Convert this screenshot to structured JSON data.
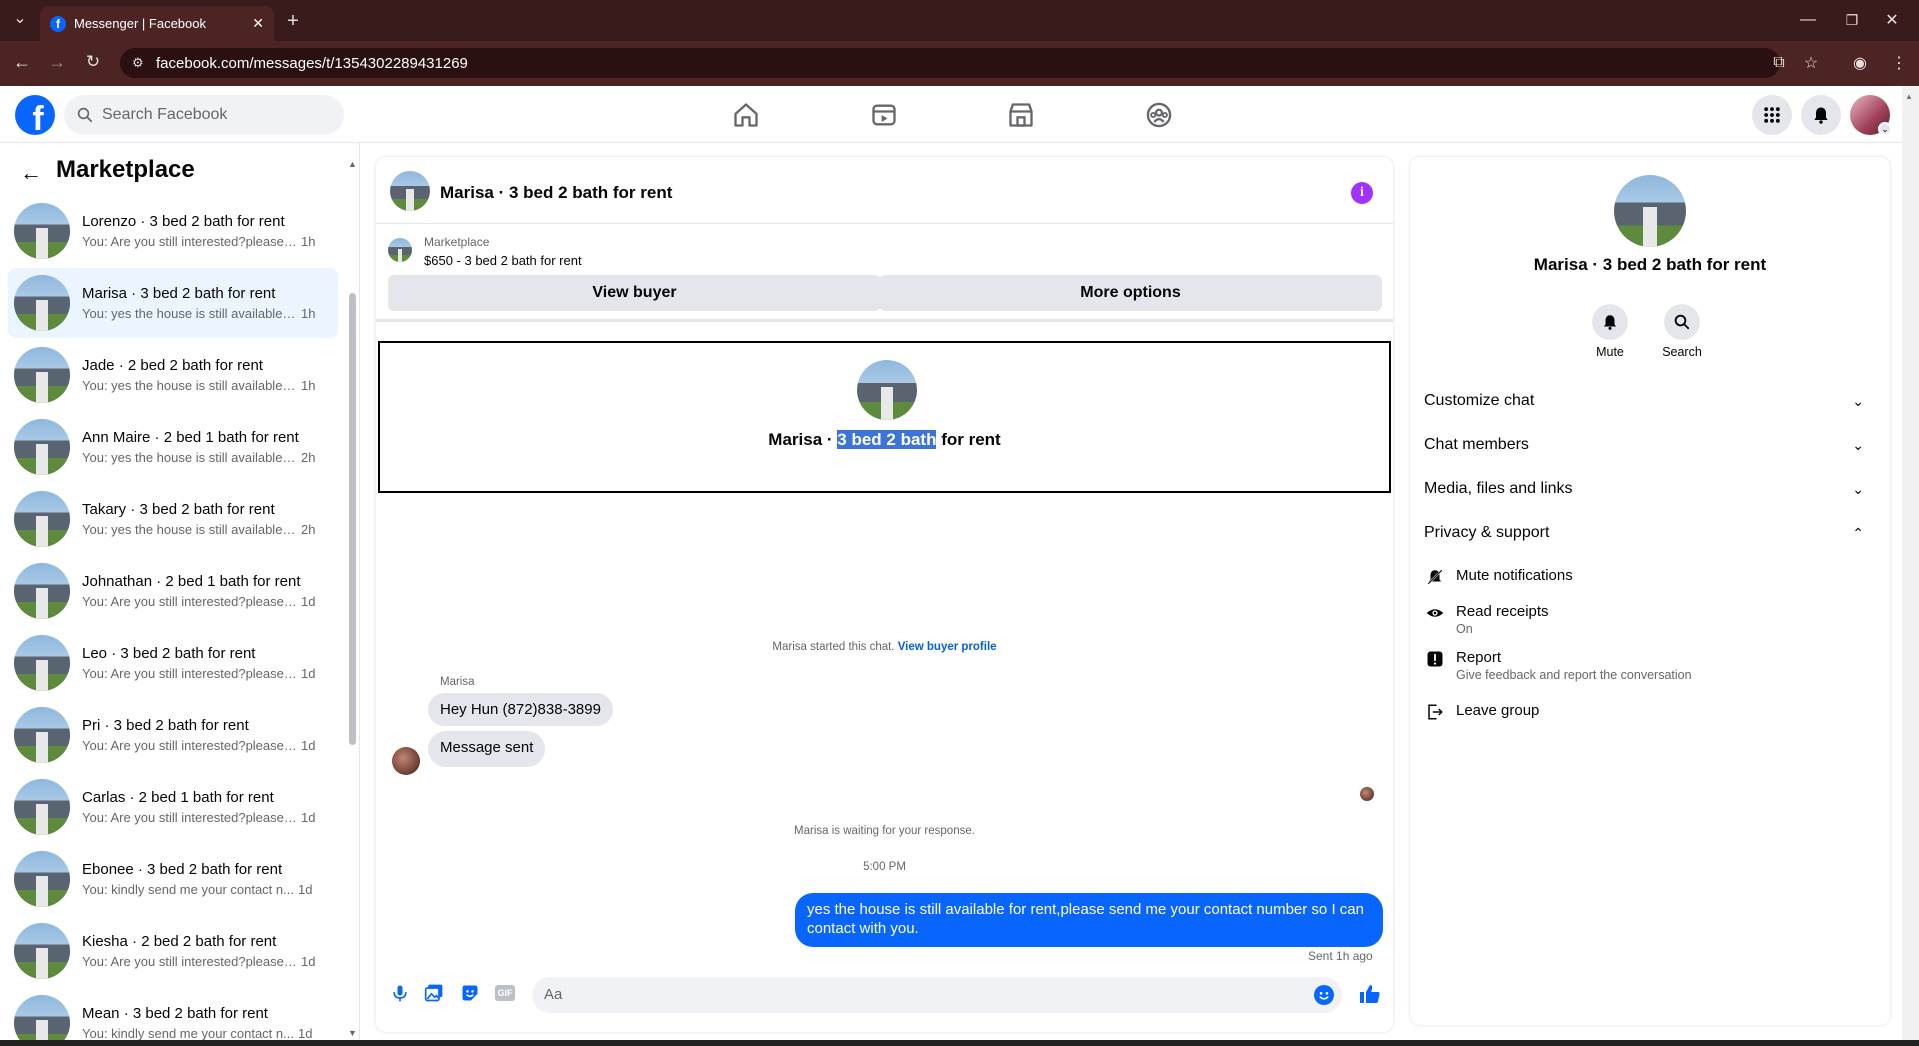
{
  "browser": {
    "tab_title": "Messenger | Facebook",
    "url": "facebook.com/messages/t/1354302289431269"
  },
  "header": {
    "search_placeholder": "Search Facebook"
  },
  "sidebar": {
    "title": "Marketplace",
    "conversations": [
      {
        "name": "Lorenzo · 3 bed 2 bath for rent",
        "preview": "You: Are you still interested?please ...",
        "time": "1h"
      },
      {
        "name": "Marisa · 3 bed 2 bath for rent",
        "preview": "You: yes the house is still available f...",
        "time": "1h",
        "active": true
      },
      {
        "name": "Jade · 2 bed 2 bath for rent",
        "preview": "You: yes the house is still available f...",
        "time": "1h"
      },
      {
        "name": "Ann Maire · 2 bed 1 bath for rent",
        "preview": "You: yes the house is still available f...",
        "time": "2h"
      },
      {
        "name": "Takary · 3 bed 2 bath for rent",
        "preview": "You: yes the house is still available f...",
        "time": "2h"
      },
      {
        "name": "Johnathan · 2 bed 1 bath for rent",
        "preview": "You: Are you still interested?please ...",
        "time": "1d"
      },
      {
        "name": "Leo · 3 bed 2 bath for rent",
        "preview": "You: Are you still interested?please ...",
        "time": "1d"
      },
      {
        "name": "Pri · 3 bed 2 bath for rent",
        "preview": "You: Are you still interested?please ...",
        "time": "1d"
      },
      {
        "name": "Carlas · 2 bed 1 bath for rent",
        "preview": "You: Are you still interested?please ...",
        "time": "1d"
      },
      {
        "name": "Ebonee · 3 bed 2 bath for rent",
        "preview": "You: kindly send me your contact n...",
        "time": "1d"
      },
      {
        "name": "Kiesha · 2 bed 2 bath for rent",
        "preview": "You: Are you still interested?please ...",
        "time": "1d"
      },
      {
        "name": "Mean · 3 bed 2 bath for rent",
        "preview": "You: kindly send me your contact n...",
        "time": "1d"
      }
    ]
  },
  "chat": {
    "title": "Marisa · 3 bed 2 bath for rent",
    "listing_label": "Marketplace",
    "listing_title": "$650 - 3 bed 2 bath for rent",
    "view_buyer": "View buyer",
    "more_options": "More options",
    "card_prefix": "Marisa · ",
    "card_highlight": "3 bed 2 bath",
    "card_suffix": " for rent",
    "started_text": "Marisa started this chat.",
    "view_buyer_profile": "View buyer profile",
    "sender_name": "Marisa",
    "msg1": "Hey Hun (872)838-3899",
    "msg2": "Message sent",
    "waiting": "Marisa is waiting for your response.",
    "time": "5:00 PM",
    "my_msg": "yes the house is still available for rent,please send me your contact number so I can contact with you.",
    "sent_status": "Sent 1h ago",
    "composer_placeholder": "Aa",
    "gif_label": "GIF"
  },
  "details": {
    "title": "Marisa · 3 bed 2 bath for rent",
    "mute": "Mute",
    "search": "Search",
    "sections": [
      "Customize chat",
      "Chat members",
      "Media, files and links",
      "Privacy & support"
    ],
    "mute_notifications": "Mute notifications",
    "read_receipts": "Read receipts",
    "read_receipts_state": "On",
    "report": "Report",
    "report_desc": "Give feedback and report the conversation",
    "leave_group": "Leave group"
  },
  "colors": {
    "brand": "#0866ff",
    "chrome_dark": "#3a1b1b",
    "chrome_bar": "#4d2424",
    "active_row": "#ebf5ff",
    "info_purple": "#a033ff",
    "highlight": "#3d74d8"
  }
}
